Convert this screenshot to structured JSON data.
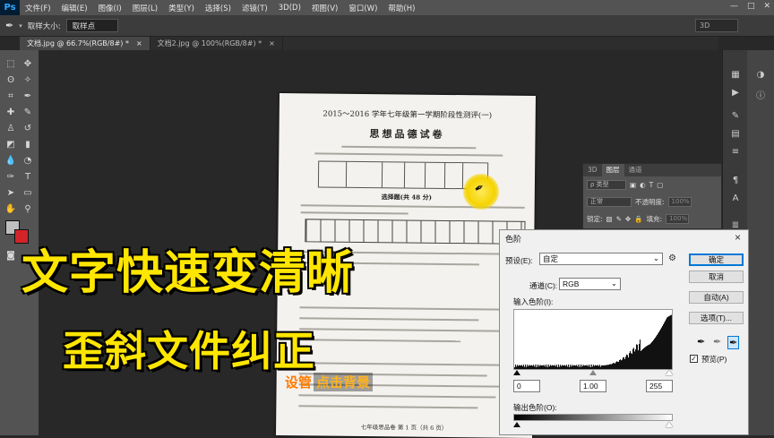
{
  "menubar": {
    "logo": "Ps",
    "items": [
      "文件(F)",
      "编辑(E)",
      "图像(I)",
      "图层(L)",
      "类型(Y)",
      "选择(S)",
      "滤镜(T)",
      "3D(D)",
      "视图(V)",
      "窗口(W)",
      "帮助(H)"
    ],
    "min": "—",
    "max": "□",
    "close": "✕"
  },
  "options": {
    "sample_label": "取样大小:",
    "sample_value": "取样点",
    "workspace": "3D"
  },
  "tabs": [
    {
      "label": "文档.jpg @ 66.7%(RGB/8#) *",
      "close": "×"
    },
    {
      "label": "文档2.jpg @ 100%(RGB/8#) *",
      "close": "×"
    }
  ],
  "document": {
    "title": "2015～2016 学年七年级第一学期阶段性测评(一)",
    "subject": "思想品德试卷",
    "section": "选择题(共 48 分)",
    "footer": "七年级思品卷  第 1 页（共 6 页）"
  },
  "layers": {
    "tabs": [
      "3D",
      "图层",
      "通道"
    ],
    "kind": "ρ 类型",
    "blend": "正常",
    "opacity_label": "不透明度:",
    "opacity": "100%",
    "lock_label": "锁定:",
    "fill_label": "填充:",
    "fill": "100%"
  },
  "overlay": {
    "title": "文字快速变清晰",
    "subtitle": "歪斜文件纠正",
    "badge_a": "设管",
    "badge_b": "点击背景"
  },
  "levels": {
    "title": "色阶",
    "close": "×",
    "preset_label": "预设(E):",
    "preset_value": "自定",
    "channel_label": "通道(C):",
    "channel_value": "RGB",
    "input_label": "输入色阶(I):",
    "input_black": "0",
    "input_gamma": "1.00",
    "input_white": "255",
    "output_label": "输出色阶(O):",
    "ok": "确定",
    "cancel": "取消",
    "auto": "自动(A)",
    "options": "选项(T)...",
    "preview": "预览(P)",
    "preview_checked": true
  }
}
